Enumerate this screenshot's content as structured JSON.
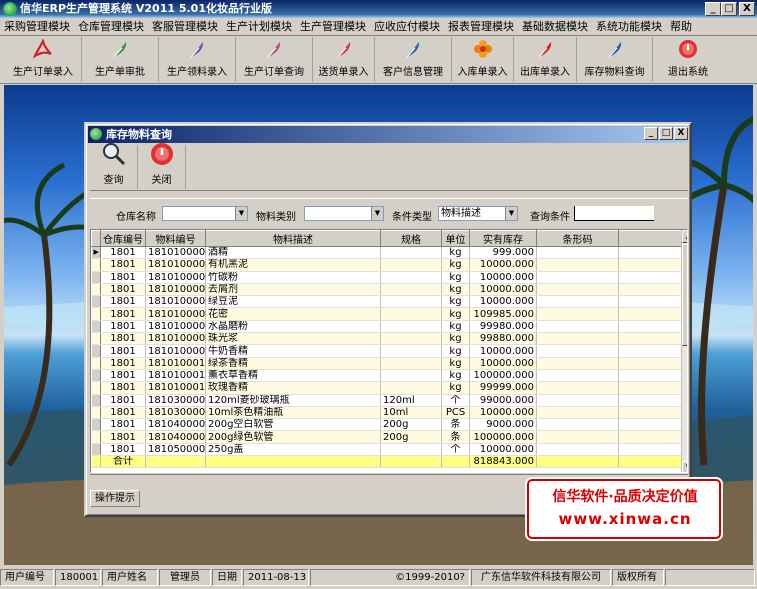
{
  "app": {
    "title": "信华ERP生产管理系统  V2011 5.01化妆品行业版",
    "controls": [
      "_",
      "□",
      "X"
    ]
  },
  "menu": [
    "采购管理模块",
    "仓库管理模块",
    "客服管理模块",
    "生产计划模块",
    "生产管理模块",
    "应收应付模块",
    "报表管理模块",
    "基础数据模块",
    "系统功能模块",
    "帮助"
  ],
  "toolbar": [
    {
      "label": "生产订单录入",
      "icon": "acrobat-icon",
      "color": "#d42020"
    },
    {
      "label": "生产单审批",
      "icon": "feather-icon",
      "color": "#3b8f3b"
    },
    {
      "label": "生产领料录入",
      "icon": "feather-icon",
      "color": "#7a4fb0"
    },
    {
      "label": "生产订单查询",
      "icon": "feather-icon",
      "color": "#c04080"
    },
    {
      "label": "送货单录入",
      "icon": "feather-icon",
      "color": "#d43070"
    },
    {
      "label": "客户信息管理",
      "icon": "feather-icon",
      "color": "#3060c0"
    },
    {
      "label": "入库单录入",
      "icon": "flower-icon",
      "color": "#e88010"
    },
    {
      "label": "出库单录入",
      "icon": "feather-icon",
      "color": "#d42020"
    },
    {
      "label": "库存物料查询",
      "icon": "feather-icon",
      "color": "#2060c0"
    },
    {
      "label": "退出系统",
      "icon": "power-icon",
      "color": "#e03030"
    }
  ],
  "child": {
    "title": "库存物料查询",
    "controls": [
      "_",
      "□",
      "X"
    ],
    "buttons": [
      {
        "label": "查询",
        "icon": "magnifier-icon"
      },
      {
        "label": "关闭",
        "icon": "power-icon"
      }
    ],
    "filter": {
      "warehouse_label": "仓库名称",
      "category_label": "物料类别",
      "condtype_label": "条件类型",
      "condtype_value": "物料描述",
      "query_label": "查询条件"
    },
    "columns": [
      "",
      "仓库编号",
      "物料编号",
      "物料描述",
      "规格",
      "单位",
      "实有库存",
      "条形码",
      ""
    ],
    "rows": [
      [
        "1801",
        "1810100001",
        "酒精",
        "",
        "kg",
        "999.000"
      ],
      [
        "1801",
        "1810100002",
        "有机黑泥",
        "",
        "kg",
        "10000.000"
      ],
      [
        "1801",
        "1810100003",
        "竹碳粉",
        "",
        "kg",
        "10000.000"
      ],
      [
        "1801",
        "1810100004",
        "去屑剂",
        "",
        "kg",
        "10000.000"
      ],
      [
        "1801",
        "1810100005",
        "绿豆泥",
        "",
        "kg",
        "10000.000"
      ],
      [
        "1801",
        "1810100006",
        "花密",
        "",
        "kg",
        "109985.000"
      ],
      [
        "1801",
        "1810100007",
        "水晶磨粉",
        "",
        "kg",
        "99980.000"
      ],
      [
        "1801",
        "1810100008",
        "珠光浆",
        "",
        "kg",
        "99880.000"
      ],
      [
        "1801",
        "1810100009",
        "牛奶香精",
        "",
        "kg",
        "10000.000"
      ],
      [
        "1801",
        "1810100010",
        "绿茶香精",
        "",
        "kg",
        "10000.000"
      ],
      [
        "1801",
        "1810100011",
        "薰衣草香精",
        "",
        "kg",
        "100000.000"
      ],
      [
        "1801",
        "1810100012",
        "玫瑰香精",
        "",
        "kg",
        "99999.000"
      ],
      [
        "1801",
        "1810300001",
        "120ml菱砂玻璃瓶",
        "120ml",
        "个",
        "99000.000"
      ],
      [
        "1801",
        "1810300002",
        "10ml茶色精油瓶",
        "10ml",
        "PCS",
        "10000.000"
      ],
      [
        "1801",
        "1810400001",
        "200g空白软管",
        "200g",
        "条",
        "9000.000"
      ],
      [
        "1801",
        "1810400002",
        "200g绿色软管",
        "200g",
        "条",
        "100000.000"
      ],
      [
        "1801",
        "1810500001",
        "250g盖",
        "",
        "个",
        "10000.000"
      ]
    ],
    "total": {
      "label": "合计",
      "value": "818843.000"
    },
    "tab": "操作提示"
  },
  "brand": {
    "line1": "信华软件·品质决定价值",
    "line2": "www.xinwa.cn"
  },
  "status": [
    "用户编号",
    "180001",
    "用户姓名",
    "管理员",
    "日期",
    "2011-08-13",
    "©1999-2010?",
    "广东信华软件科技有限公司",
    "版权所有"
  ],
  "colors": {
    "title": "#0a246a",
    "accent": "#d00000",
    "total_row": "#ffff80",
    "alt_row": "#fffbe0"
  }
}
